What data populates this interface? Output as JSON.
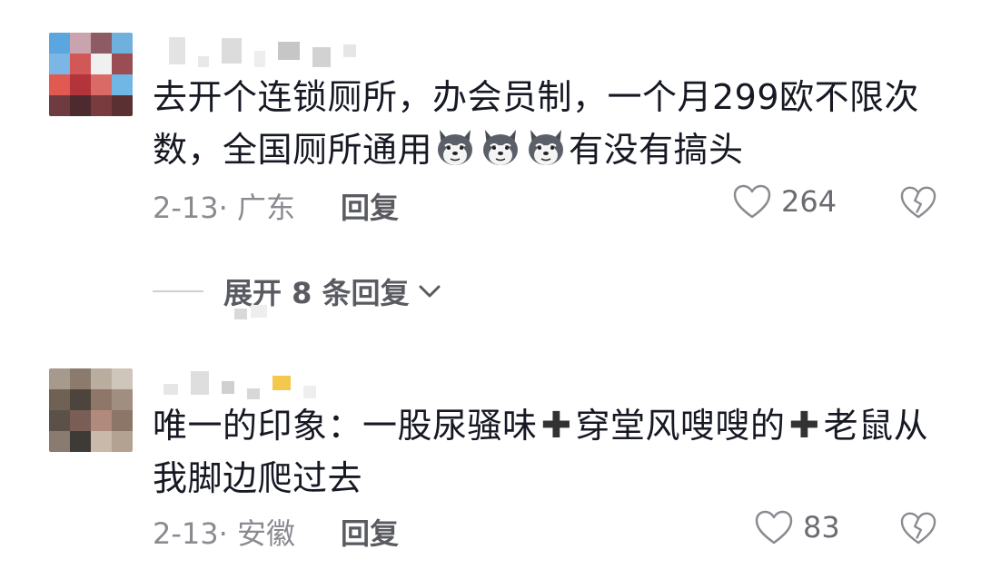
{
  "comments": [
    {
      "text_before_emoji": "去开个连锁厕所，办会员制，一个月299欧不限次数，全国厕所通用",
      "emoji_count": 3,
      "emoji_icon": "husky-dog-emoji",
      "text_after_emoji": "有没有搞头",
      "date_location": "2-13· 广东",
      "reply_label": "回复",
      "likes": "264"
    },
    {
      "text_part1": "唯一的印象：一股尿骚味",
      "text_part2": "穿堂风嗖嗖的",
      "text_part3": "老鼠从我脚边爬过去",
      "plus_icon": "heavy-plus-icon",
      "date_location": "2-13· 安徽",
      "reply_label": "回复",
      "likes": "83"
    }
  ],
  "expand_replies": {
    "label": "展开 8 条回复"
  },
  "colors": {
    "text": "#161823",
    "meta": "#8a8b91",
    "background": "#ffffff"
  }
}
